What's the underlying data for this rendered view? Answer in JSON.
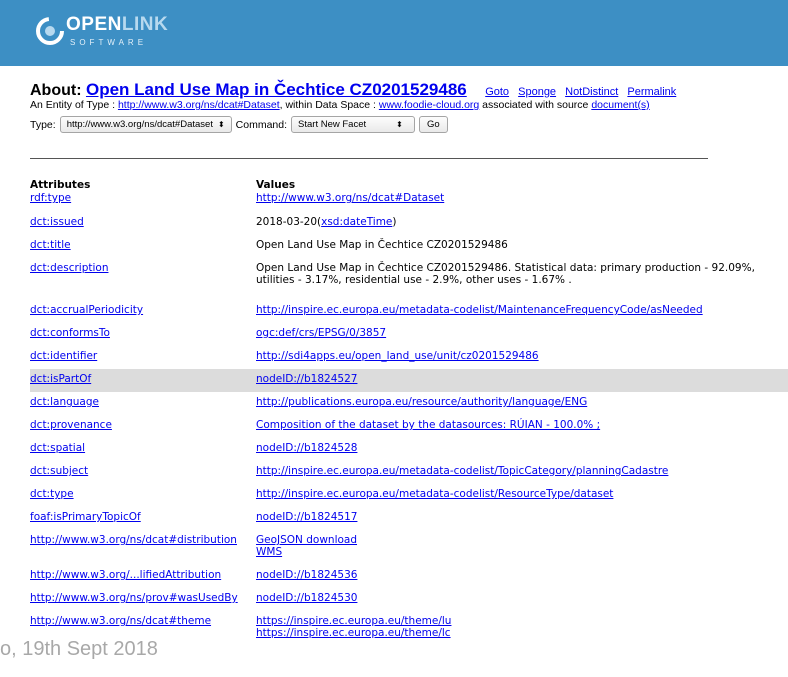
{
  "banner": {
    "logo_word_a": "OPEN",
    "logo_word_b": "LINK",
    "logo_sub": "SOFTWARE",
    "color": "#3d8fc4"
  },
  "about": {
    "label": "About:",
    "title": "Open Land Use Map in Čechtice CZ0201529486",
    "links": [
      "Goto",
      "Sponge",
      "NotDistinct",
      "Permalink"
    ]
  },
  "entity": {
    "prefix": "An Entity of Type :",
    "type_link": "http://www.w3.org/ns/dcat#Dataset",
    "middle": ", within Data Space :",
    "space_link": "www.foodie-cloud.org",
    "suffix": "associated with source",
    "source_link": "document(s)"
  },
  "controls": {
    "type_label": "Type:",
    "type_value": "http://www.w3.org/ns/dcat#Dataset",
    "command_label": "Command:",
    "command_value": "Start New Facet",
    "go_label": "Go"
  },
  "table": {
    "headers": [
      "Attributes",
      "Values"
    ],
    "rdf_type": {
      "attr": "rdf:type",
      "value": "http://www.w3.org/ns/dcat#Dataset"
    },
    "rows": [
      {
        "attr": "dct:issued",
        "value_text": "2018-03-20(",
        "value_link": "xsd:dateTime",
        "value_after": ")"
      },
      {
        "attr": "dct:title",
        "value_plain": "Open Land Use Map in Čechtice CZ0201529486"
      },
      {
        "attr": "dct:description",
        "value_line1": "Open Land Use Map in Čechtice CZ0201529486. Statistical data: primary production - 92.09%,",
        "value_line2": "utilities - 3.17%, residential use - 2.9%, other uses - 1.67% ."
      },
      {
        "attr": "dct:accrualPeriodicity",
        "value": "http://inspire.ec.europa.eu/metadata-codelist/MaintenanceFrequencyCode/asNeeded"
      },
      {
        "attr": "dct:conformsTo",
        "value": "ogc:def/crs/EPSG/0/3857"
      },
      {
        "attr": "dct:identifier",
        "value": "http://sdi4apps.eu/open_land_use/unit/cz0201529486"
      },
      {
        "attr": "dct:isPartOf",
        "value": "nodeID://b1824527"
      },
      {
        "attr": "dct:language",
        "value": "http://publications.europa.eu/resource/authority/language/ENG"
      },
      {
        "attr": "dct:provenance",
        "value": "Composition of the dataset by the datasources: RÚIAN - 100.0% ;"
      },
      {
        "attr": "dct:spatial",
        "value": "nodeID://b1824528"
      },
      {
        "attr": "dct:subject",
        "value": "http://inspire.ec.europa.eu/metadata-codelist/TopicCategory/planningCadastre"
      },
      {
        "attr": "dct:type",
        "value": "http://inspire.ec.europa.eu/metadata-codelist/ResourceType/dataset"
      },
      {
        "attr": "foaf:isPrimaryTopicOf",
        "value": "nodeID://b1824517"
      },
      {
        "attr": "http://www.w3.org/ns/dcat#distribution",
        "value": "GeoJSON download",
        "value2": "WMS"
      },
      {
        "attr": "http://www.w3.org/...lifiedAttribution",
        "value": "nodeID://b1824536"
      },
      {
        "attr": "http://www.w3.org/ns/prov#wasUsedBy",
        "value": "nodeID://b1824530"
      },
      {
        "attr": "http://www.w3.org/ns/dcat#theme",
        "value": "https://inspire.ec.europa.eu/theme/lu",
        "value2": "https://inspire.ec.europa.eu/theme/lc"
      }
    ]
  },
  "watermark": "o, 19th Sept 2018"
}
